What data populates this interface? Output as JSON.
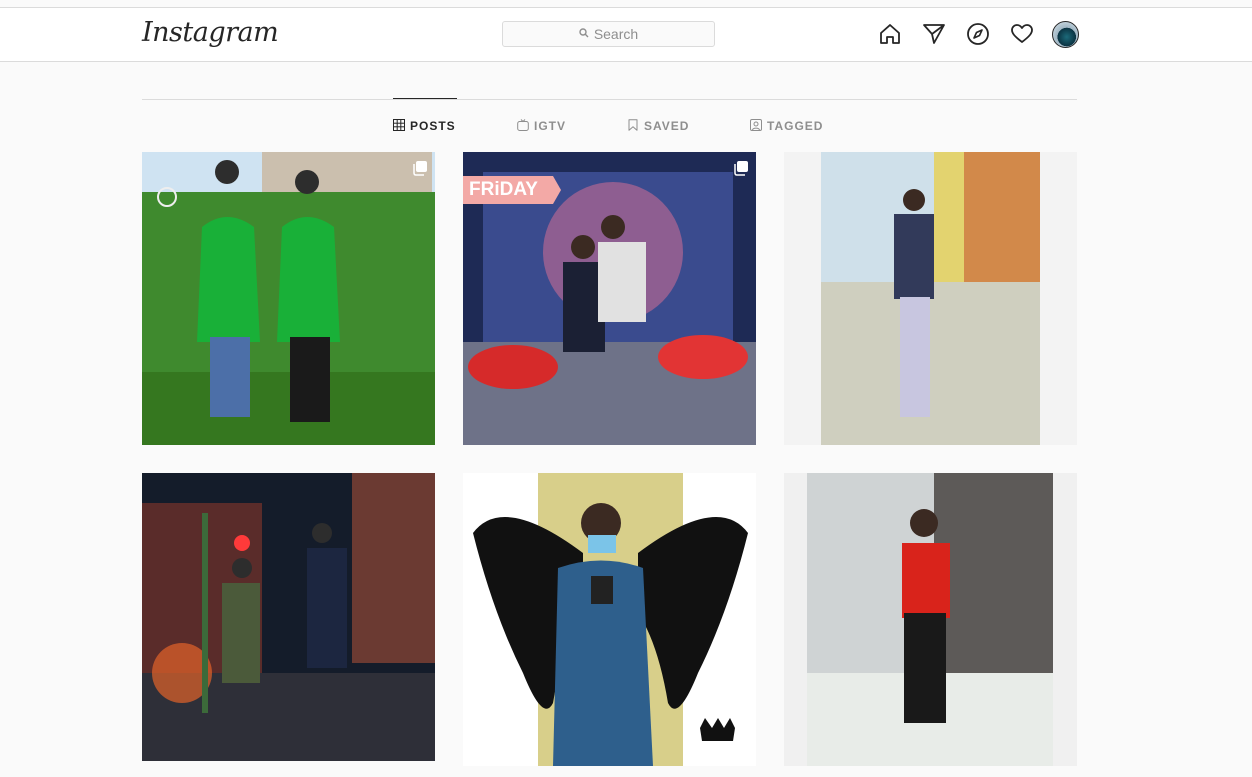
{
  "header": {
    "logo_text": "Instagram",
    "search_placeholder": "Search",
    "search_icon": "search-icon",
    "nav_icons": [
      "home-icon",
      "direct-message-icon",
      "explore-compass-icon",
      "activity-heart-icon"
    ]
  },
  "tabs": [
    {
      "label": "POSTS",
      "icon": "grid-icon",
      "active": true
    },
    {
      "label": "IGTV",
      "icon": "igtv-icon",
      "active": false
    },
    {
      "label": "SAVED",
      "icon": "bookmark-icon",
      "active": false
    },
    {
      "label": "TAGGED",
      "icon": "tagged-person-icon",
      "active": false
    }
  ],
  "posts": [
    {
      "scene": "two young men in green shirts on a field",
      "multiple": true
    },
    {
      "scene": "two young men posing before a mural",
      "multiple": true,
      "overlay_text": "FRiDAY"
    },
    {
      "scene": "young man standing on a balcony",
      "multiple": false
    },
    {
      "scene": "two young men at night in the street",
      "multiple": false
    },
    {
      "scene": "mirror selfie with black wings",
      "multiple": false
    },
    {
      "scene": "young man in red jersey in hallway",
      "multiple": false
    }
  ],
  "colors": {
    "border": "#dbdbdb",
    "text": "#262626",
    "muted": "#8e8e8e",
    "background": "#fafafa"
  }
}
